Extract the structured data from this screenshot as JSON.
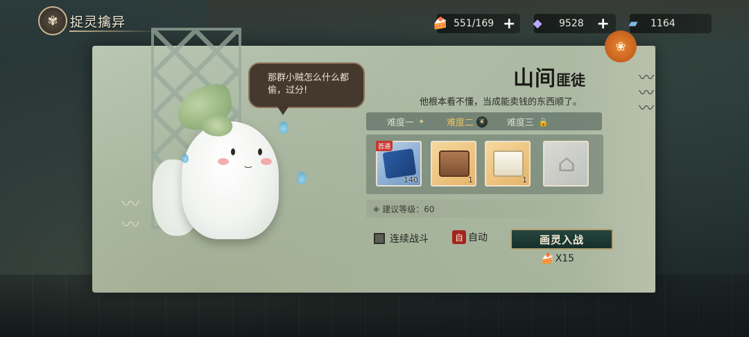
{
  "header": {
    "title": "捉灵擒异",
    "emblem_icon": "butterfly-icon"
  },
  "resources": [
    {
      "name": "cake",
      "icon": "cake-icon",
      "value": "551/169",
      "has_plus": true
    },
    {
      "name": "diamond",
      "icon": "diamond-icon",
      "value": "9528",
      "has_plus": true
    },
    {
      "name": "ticket",
      "icon": "ticket-icon",
      "value": "1164",
      "has_plus": false
    }
  ],
  "dialogue": {
    "text": "那群小贼怎么什么都偷，过分!"
  },
  "stage": {
    "name_main": "山间",
    "name_sub": "匪徒",
    "description": "他根本看不懂，当成能卖钱的东西顺了。"
  },
  "difficulty": {
    "tabs": [
      {
        "label": "难度一",
        "state": "normal"
      },
      {
        "label": "难度二",
        "state": "selected"
      },
      {
        "label": "难度三",
        "state": "locked"
      }
    ]
  },
  "rewards": [
    {
      "name": "book",
      "count": "140",
      "first_clear_tag": "首通"
    },
    {
      "name": "wooden-chest",
      "count": "1"
    },
    {
      "name": "white-box",
      "count": "1"
    },
    {
      "name": "unknown-item",
      "count": ""
    }
  ],
  "suggest_level": "建议等级：60",
  "controls": {
    "continuous_battle": "连续战斗",
    "auto": "自动",
    "auto_icon_text": "自",
    "battle_button": "画灵入战",
    "cost": "X15"
  },
  "colors": {
    "accent_gold": "#f1c25b",
    "button_bg": "#16302b",
    "panel_bg": "#b9c6b2",
    "auto_red": "#a4251d"
  }
}
